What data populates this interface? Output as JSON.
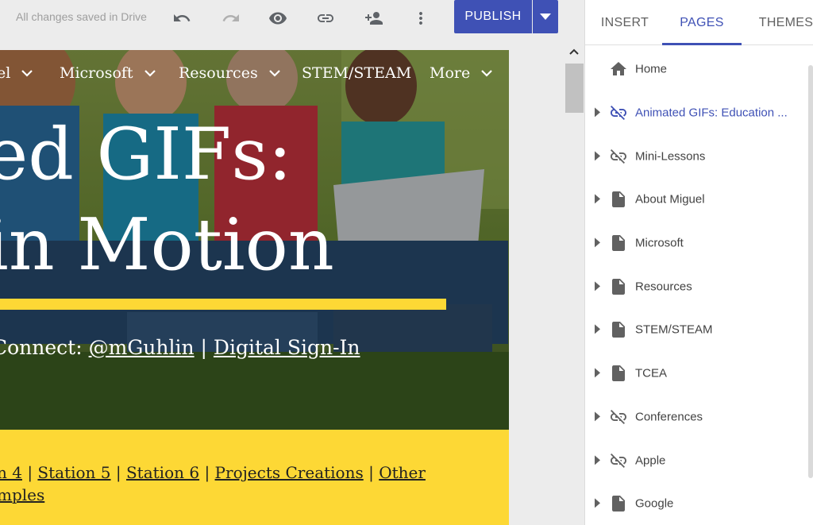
{
  "toolbar": {
    "save_status": "All changes saved in Drive",
    "publish_label": "PUBLISH",
    "icons": [
      "undo-icon",
      "redo-icon",
      "preview-icon",
      "link-icon",
      "share-icon",
      "more-vert-icon",
      "chevron-down-icon"
    ]
  },
  "site": {
    "nav": {
      "items": [
        "el",
        "Microsoft",
        "Resources",
        "STEM/STEAM",
        "More"
      ]
    },
    "hero": {
      "title_line1": "ed GIFs:",
      "title_line2": "in Motion",
      "connect_prefix": "Connect: ",
      "connect_handle": "@mGuhlin",
      "connect_sep": " | ",
      "connect_signin": "Digital Sign-In"
    },
    "station_links": {
      "items": [
        "n 4",
        "Station 5",
        "Station 6",
        "Projects Creations",
        "Other"
      ],
      "separator": " | ",
      "second_line": "mples"
    },
    "colors": {
      "accent_yellow": "#fdd835",
      "publish_blue": "#3f51b5"
    }
  },
  "panel": {
    "tabs": [
      {
        "label": "INSERT"
      },
      {
        "label": "PAGES",
        "active": true
      },
      {
        "label": "THEMES"
      }
    ],
    "pages": [
      {
        "label": "Home",
        "icon": "home-icon",
        "caret": false,
        "active": false
      },
      {
        "label": "Animated GIFs: Education ...",
        "icon": "link-off-icon",
        "caret": true,
        "active": true
      },
      {
        "label": "Mini-Lessons",
        "icon": "link-off-icon",
        "caret": true,
        "active": false
      },
      {
        "label": "About Miguel",
        "icon": "page-icon",
        "caret": true,
        "active": false
      },
      {
        "label": "Microsoft",
        "icon": "page-icon",
        "caret": true,
        "active": false
      },
      {
        "label": "Resources",
        "icon": "page-icon",
        "caret": true,
        "active": false
      },
      {
        "label": "STEM/STEAM",
        "icon": "page-icon",
        "caret": true,
        "active": false
      },
      {
        "label": "TCEA",
        "icon": "page-icon",
        "caret": true,
        "active": false
      },
      {
        "label": "Conferences",
        "icon": "link-off-icon",
        "caret": true,
        "active": false
      },
      {
        "label": "Apple",
        "icon": "link-off-icon",
        "caret": true,
        "active": false
      },
      {
        "label": "Google",
        "icon": "page-icon",
        "caret": true,
        "active": false
      }
    ]
  }
}
